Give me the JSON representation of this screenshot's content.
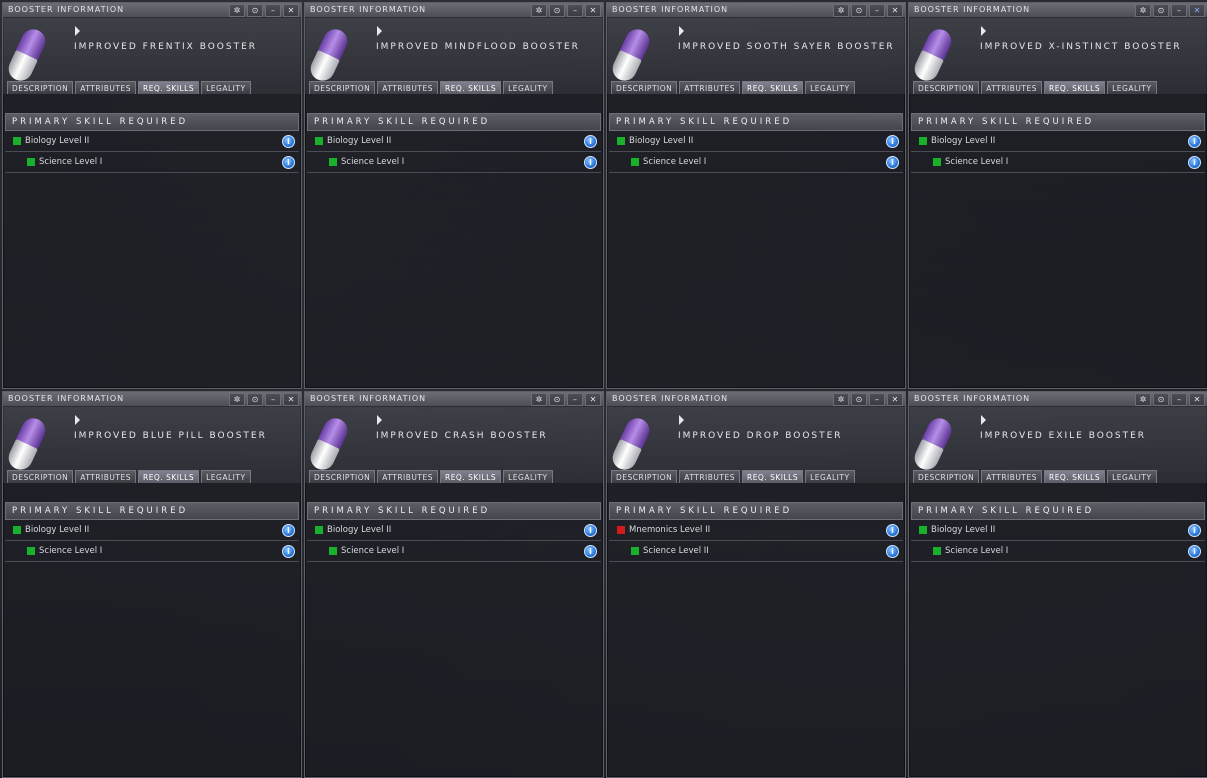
{
  "tabs": [
    "DESCRIPTION",
    "ATTRIBUTES",
    "REQ. SKILLS",
    "LEGALITY"
  ],
  "active_tab": "REQ. SKILLS",
  "section_label": "PRIMARY SKILL REQUIRED",
  "window_buttons": [
    "✲",
    "⊙",
    "–",
    "✕"
  ],
  "windows": [
    {
      "title": "BOOSTER INFORMATION",
      "item": "IMPROVED FRENTIX BOOSTER",
      "skills": [
        {
          "label": "Biology Level II",
          "status": "green"
        },
        {
          "label": "Science Level I",
          "status": "green"
        }
      ]
    },
    {
      "title": "BOOSTER INFORMATION",
      "item": "IMPROVED MINDFLOOD BOOSTER",
      "skills": [
        {
          "label": "Biology Level II",
          "status": "green"
        },
        {
          "label": "Science Level I",
          "status": "green"
        }
      ]
    },
    {
      "title": "BOOSTER INFORMATION",
      "item": "IMPROVED SOOTH SAYER BOOSTER",
      "skills": [
        {
          "label": "Biology Level II",
          "status": "green"
        },
        {
          "label": "Science Level I",
          "status": "green"
        }
      ]
    },
    {
      "title": "BOOSTER INFORMATION",
      "item": "IMPROVED X-INSTINCT BOOSTER",
      "skills": [
        {
          "label": "Biology Level II",
          "status": "green"
        },
        {
          "label": "Science Level I",
          "status": "green"
        }
      ]
    },
    {
      "title": "BOOSTER INFORMATION",
      "item": "IMPROVED BLUE PILL BOOSTER",
      "skills": [
        {
          "label": "Biology Level II",
          "status": "green"
        },
        {
          "label": "Science Level I",
          "status": "green"
        }
      ]
    },
    {
      "title": "BOOSTER INFORMATION",
      "item": "IMPROVED CRASH BOOSTER",
      "skills": [
        {
          "label": "Biology Level II",
          "status": "green"
        },
        {
          "label": "Science Level I",
          "status": "green"
        }
      ]
    },
    {
      "title": "BOOSTER INFORMATION",
      "item": "IMPROVED DROP BOOSTER",
      "skills": [
        {
          "label": "Mnemonics Level II",
          "status": "red"
        },
        {
          "label": "Science Level II",
          "status": "green"
        }
      ]
    },
    {
      "title": "BOOSTER INFORMATION",
      "item": "IMPROVED EXILE BOOSTER",
      "skills": [
        {
          "label": "Biology Level II",
          "status": "green"
        },
        {
          "label": "Science Level I",
          "status": "green"
        }
      ]
    }
  ],
  "colors": {
    "skill_trained": "#19b02b",
    "skill_missing": "#d21c1c",
    "info_icon": "#2f7fe0"
  },
  "icons": {
    "item": "booster-pill-icon",
    "info": "info-icon"
  }
}
